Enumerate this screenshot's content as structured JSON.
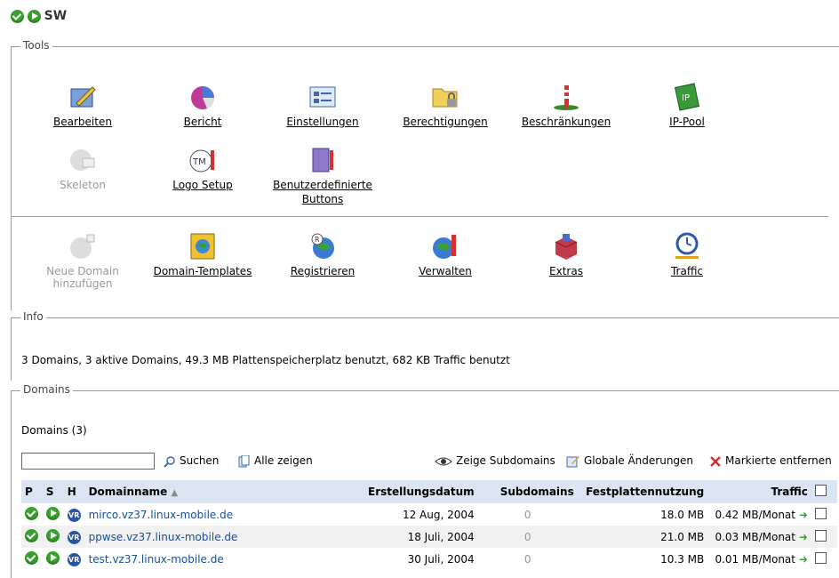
{
  "header": {
    "title": "SW"
  },
  "tools": {
    "legend": "Tools",
    "row1": [
      {
        "label": "Bearbeiten",
        "icon": "edit-icon",
        "enabled": true
      },
      {
        "label": "Bericht",
        "icon": "report-icon",
        "enabled": true
      },
      {
        "label": "Einstellungen",
        "icon": "settings-icon",
        "enabled": true
      },
      {
        "label": "Berechtigungen",
        "icon": "permissions-icon",
        "enabled": true
      },
      {
        "label": "Beschränkungen",
        "icon": "limits-icon",
        "enabled": true
      },
      {
        "label": "IP-Pool",
        "icon": "ip-pool-icon",
        "enabled": true
      }
    ],
    "row2": [
      {
        "label": "Skeleton",
        "icon": "skeleton-icon",
        "enabled": false
      },
      {
        "label": "Logo Setup",
        "icon": "logo-setup-icon",
        "enabled": true
      },
      {
        "label_line1": "Benutzerdefinierte",
        "label_line2": "Buttons",
        "icon": "custom-buttons-icon",
        "enabled": true
      }
    ],
    "row3": [
      {
        "label_line1": "Neue Domain",
        "label_line2": "hinzufügen",
        "icon": "add-domain-icon",
        "enabled": false
      },
      {
        "label": "Domain-Templates",
        "icon": "domain-templates-icon",
        "enabled": true
      },
      {
        "label": "Registrieren",
        "icon": "register-icon",
        "enabled": true
      },
      {
        "label": "Verwalten",
        "icon": "manage-icon",
        "enabled": true
      },
      {
        "label": "Extras",
        "icon": "extras-icon",
        "enabled": true
      },
      {
        "label": "Traffic",
        "icon": "traffic-icon",
        "enabled": true
      }
    ]
  },
  "info": {
    "legend": "Info",
    "text": "3 Domains, 3 aktive Domains, 49.3 MB Plattenspeicherplatz benutzt, 682 KB Traffic benutzt"
  },
  "domains": {
    "legend": "Domains",
    "count_label": "Domains (3)",
    "search_value": "",
    "search_label": "Suchen",
    "show_all_label": "Alle zeigen",
    "show_subdomains_label": "Zeige Subdomains",
    "global_changes_label": "Globale Änderungen",
    "remove_selected_label": "Markierte entfernen",
    "columns": {
      "p": "P",
      "s": "S",
      "h": "H",
      "name": "Domainname",
      "created": "Erstellungsdatum",
      "subdomains": "Subdomains",
      "disk": "Festplattennutzung",
      "traffic": "Traffic"
    },
    "rows": [
      {
        "name": "mirco.vz37.linux-mobile.de",
        "created": "12 Aug, 2004",
        "subdomains": "0",
        "disk": "18.0 MB",
        "traffic": "0.42 MB/Monat"
      },
      {
        "name": "ppwse.vz37.linux-mobile.de",
        "created": "18 Juli, 2004",
        "subdomains": "0",
        "disk": "21.0 MB",
        "traffic": "0.03 MB/Monat"
      },
      {
        "name": "test.vz37.linux-mobile.de",
        "created": "30 Juli, 2004",
        "subdomains": "0",
        "disk": "10.3 MB",
        "traffic": "0.01 MB/Monat"
      }
    ]
  },
  "colors": {
    "accent": "#3aa12e",
    "header_bg": "#dbe4f2",
    "link": "#1a4fa0"
  }
}
